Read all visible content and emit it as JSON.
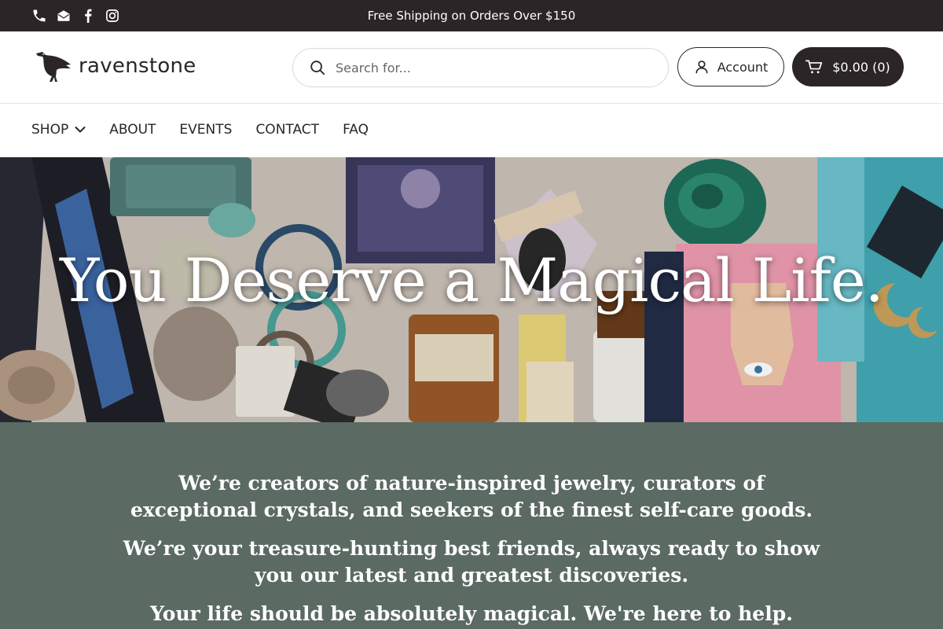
{
  "announcement": {
    "text": "Free Shipping on Orders Over $150",
    "icons": [
      "phone-icon",
      "email-icon",
      "facebook-icon",
      "instagram-icon"
    ]
  },
  "header": {
    "logo_text": "ravenstone",
    "search_placeholder": "Search for...",
    "account_label": "Account",
    "cart_label": "$0.00 (0)"
  },
  "nav": {
    "items": [
      "SHOP",
      "ABOUT",
      "EVENTS",
      "CONTACT",
      "FAQ"
    ]
  },
  "hero": {
    "headline": "You Deserve a Magical Life."
  },
  "intro": {
    "p1": "We’re creators of nature-inspired jewelry, curators of exceptional crystals, and seekers of the finest self-care goods.",
    "p2": "We’re your treasure-hunting best friends, always ready to show you our latest and greatest discoveries.",
    "p3": "Your life should be absolutely magical. We're here to help."
  },
  "colors": {
    "dark": "#2b2528",
    "intro_bg": "#5b6a63",
    "white": "#ffffff"
  }
}
